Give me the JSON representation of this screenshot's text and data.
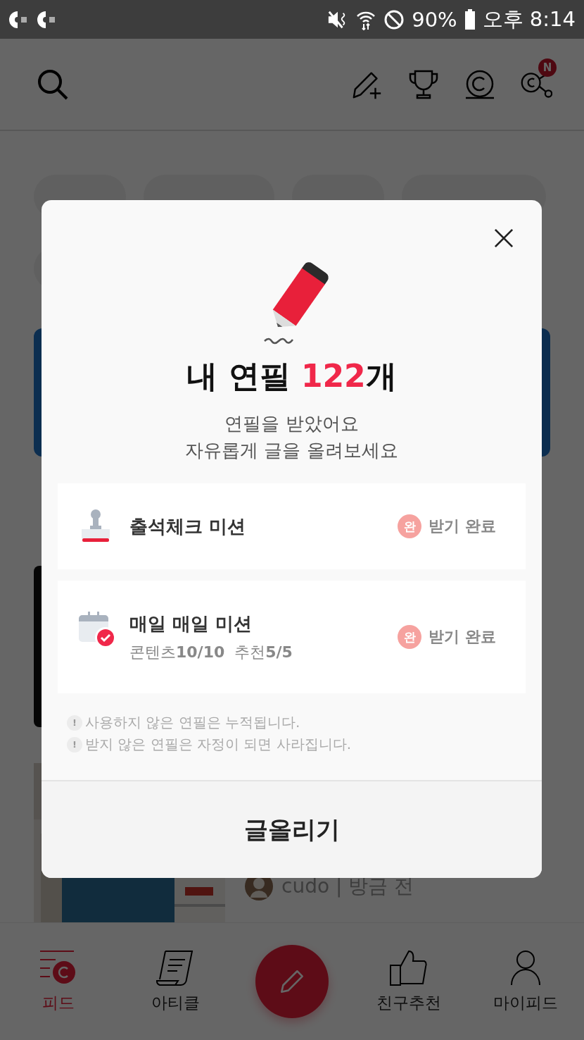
{
  "status_bar": {
    "battery": "90%",
    "time": "오후 8:14"
  },
  "header": {
    "badge": "N"
  },
  "post": {
    "author_line": "cudo | 방금 전"
  },
  "modal": {
    "title": {
      "before": "내 연필 ",
      "count": "122",
      "after": "개"
    },
    "subtitle": [
      "연필을 받았어요",
      "자유롭게 글을 올려보세요"
    ],
    "missions": [
      {
        "kind": "stamp",
        "title": "출석체크 미션",
        "status_mark": "완",
        "status": "받기 완료",
        "completed": true
      },
      {
        "kind": "calendar",
        "title": "매일 매일 미션",
        "detail": "콘텐츠**10/10**  추천**5/5**",
        "status_mark": "완",
        "status": "받기 완료",
        "completed": true
      }
    ],
    "notes": [
      {
        "mark": "!",
        "text": "사용하지 않은 연필은 누적됩니다."
      },
      {
        "mark": "!",
        "text": "받지 않은 연필은 자정이 되면 사라집니다."
      }
    ],
    "button": "글올리기"
  },
  "nav": [
    {
      "kind": "feed",
      "label": "피드",
      "selected": true
    },
    {
      "kind": "article",
      "label": "아티클",
      "selected": false
    },
    {
      "kind": "compose"
    },
    {
      "kind": "friends",
      "label": "친구추천",
      "selected": false
    },
    {
      "kind": "my",
      "label": "마이피드",
      "selected": false
    }
  ]
}
